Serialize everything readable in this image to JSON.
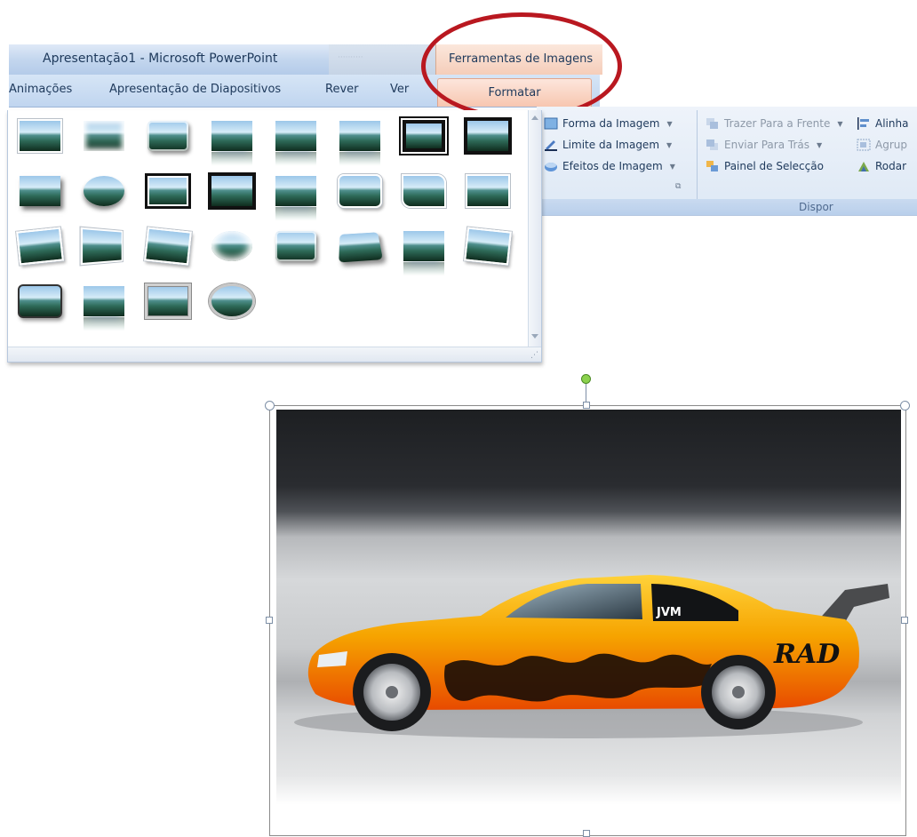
{
  "window": {
    "title": "Apresentação1 - Microsoft PowerPoint",
    "contextual_tools_label": "Ferramentas de Imagens"
  },
  "tabs": [
    {
      "label": "Animações"
    },
    {
      "label": "Apresentação de Diapositivos"
    },
    {
      "label": "Rever"
    },
    {
      "label": "Ver"
    },
    {
      "label": "Formatar",
      "active": true
    }
  ],
  "ribbon": {
    "image_styles": {
      "shape_label": "Forma da Imagem",
      "border_label": "Limite da Imagem",
      "effects_label": "Efeitos de Imagem"
    },
    "arrange": {
      "group_label": "Dispor",
      "bring_front_label": "Trazer Para a Frente",
      "send_back_label": "Enviar Para Trás",
      "selection_pane_label": "Painel de Selecção",
      "align_label": "Alinha",
      "group_btn_label": "Agrup",
      "rotate_label": "Rodar"
    }
  },
  "gallery": {
    "styles": [
      "simple-frame-white",
      "soft-edge-rectangle",
      "bevel-rectangle",
      "reflected-rounded",
      "reflected-soft",
      "soft-edge-reflected",
      "thick-black-frame",
      "black-frame",
      "drop-shadow",
      "oval-shadow",
      "double-black-frame",
      "black-border",
      "reflected-bevel",
      "rounded-white",
      "corner-cut-white",
      "simple-white-shadow",
      "rotated-white-left",
      "perspective-white",
      "tilted-white",
      "soft-ellipse",
      "bevel-rounded",
      "bevel-perspective",
      "reflected-simple",
      "rotated-white-right",
      "rounded-dark",
      "reflected-white",
      "gray-frame",
      "oval-ring"
    ]
  },
  "colors": {
    "accent_highlight": "#b91820",
    "car_body": "#f6a400",
    "rotation_handle": "#8bd14d"
  },
  "picture": {
    "decal_text": "JVM",
    "logo_text": "RAD"
  }
}
